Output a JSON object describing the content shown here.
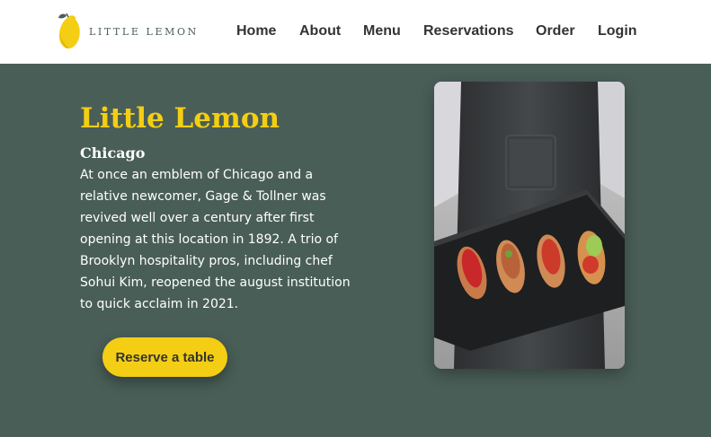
{
  "brand": {
    "name": "LITTLE LEMON",
    "icon": "lemon-icon"
  },
  "nav": [
    "Home",
    "About",
    "Menu",
    "Reservations",
    "Order",
    "Login"
  ],
  "hero": {
    "title": "Little Lemon",
    "subtitle": "Chicago",
    "description": "At once an emblem of Chicago and a relative newcomer, Gage & Tollner was revived well over a century after first opening at this location in 1892. A trio of Brooklyn hospitality pros, including chef Sohui Kim, reopened the august institution to quick acclaim in 2021.",
    "cta": "Reserve a table"
  },
  "colors": {
    "primary": "#495e57",
    "accent": "#f4ce14",
    "text": "#333333"
  }
}
